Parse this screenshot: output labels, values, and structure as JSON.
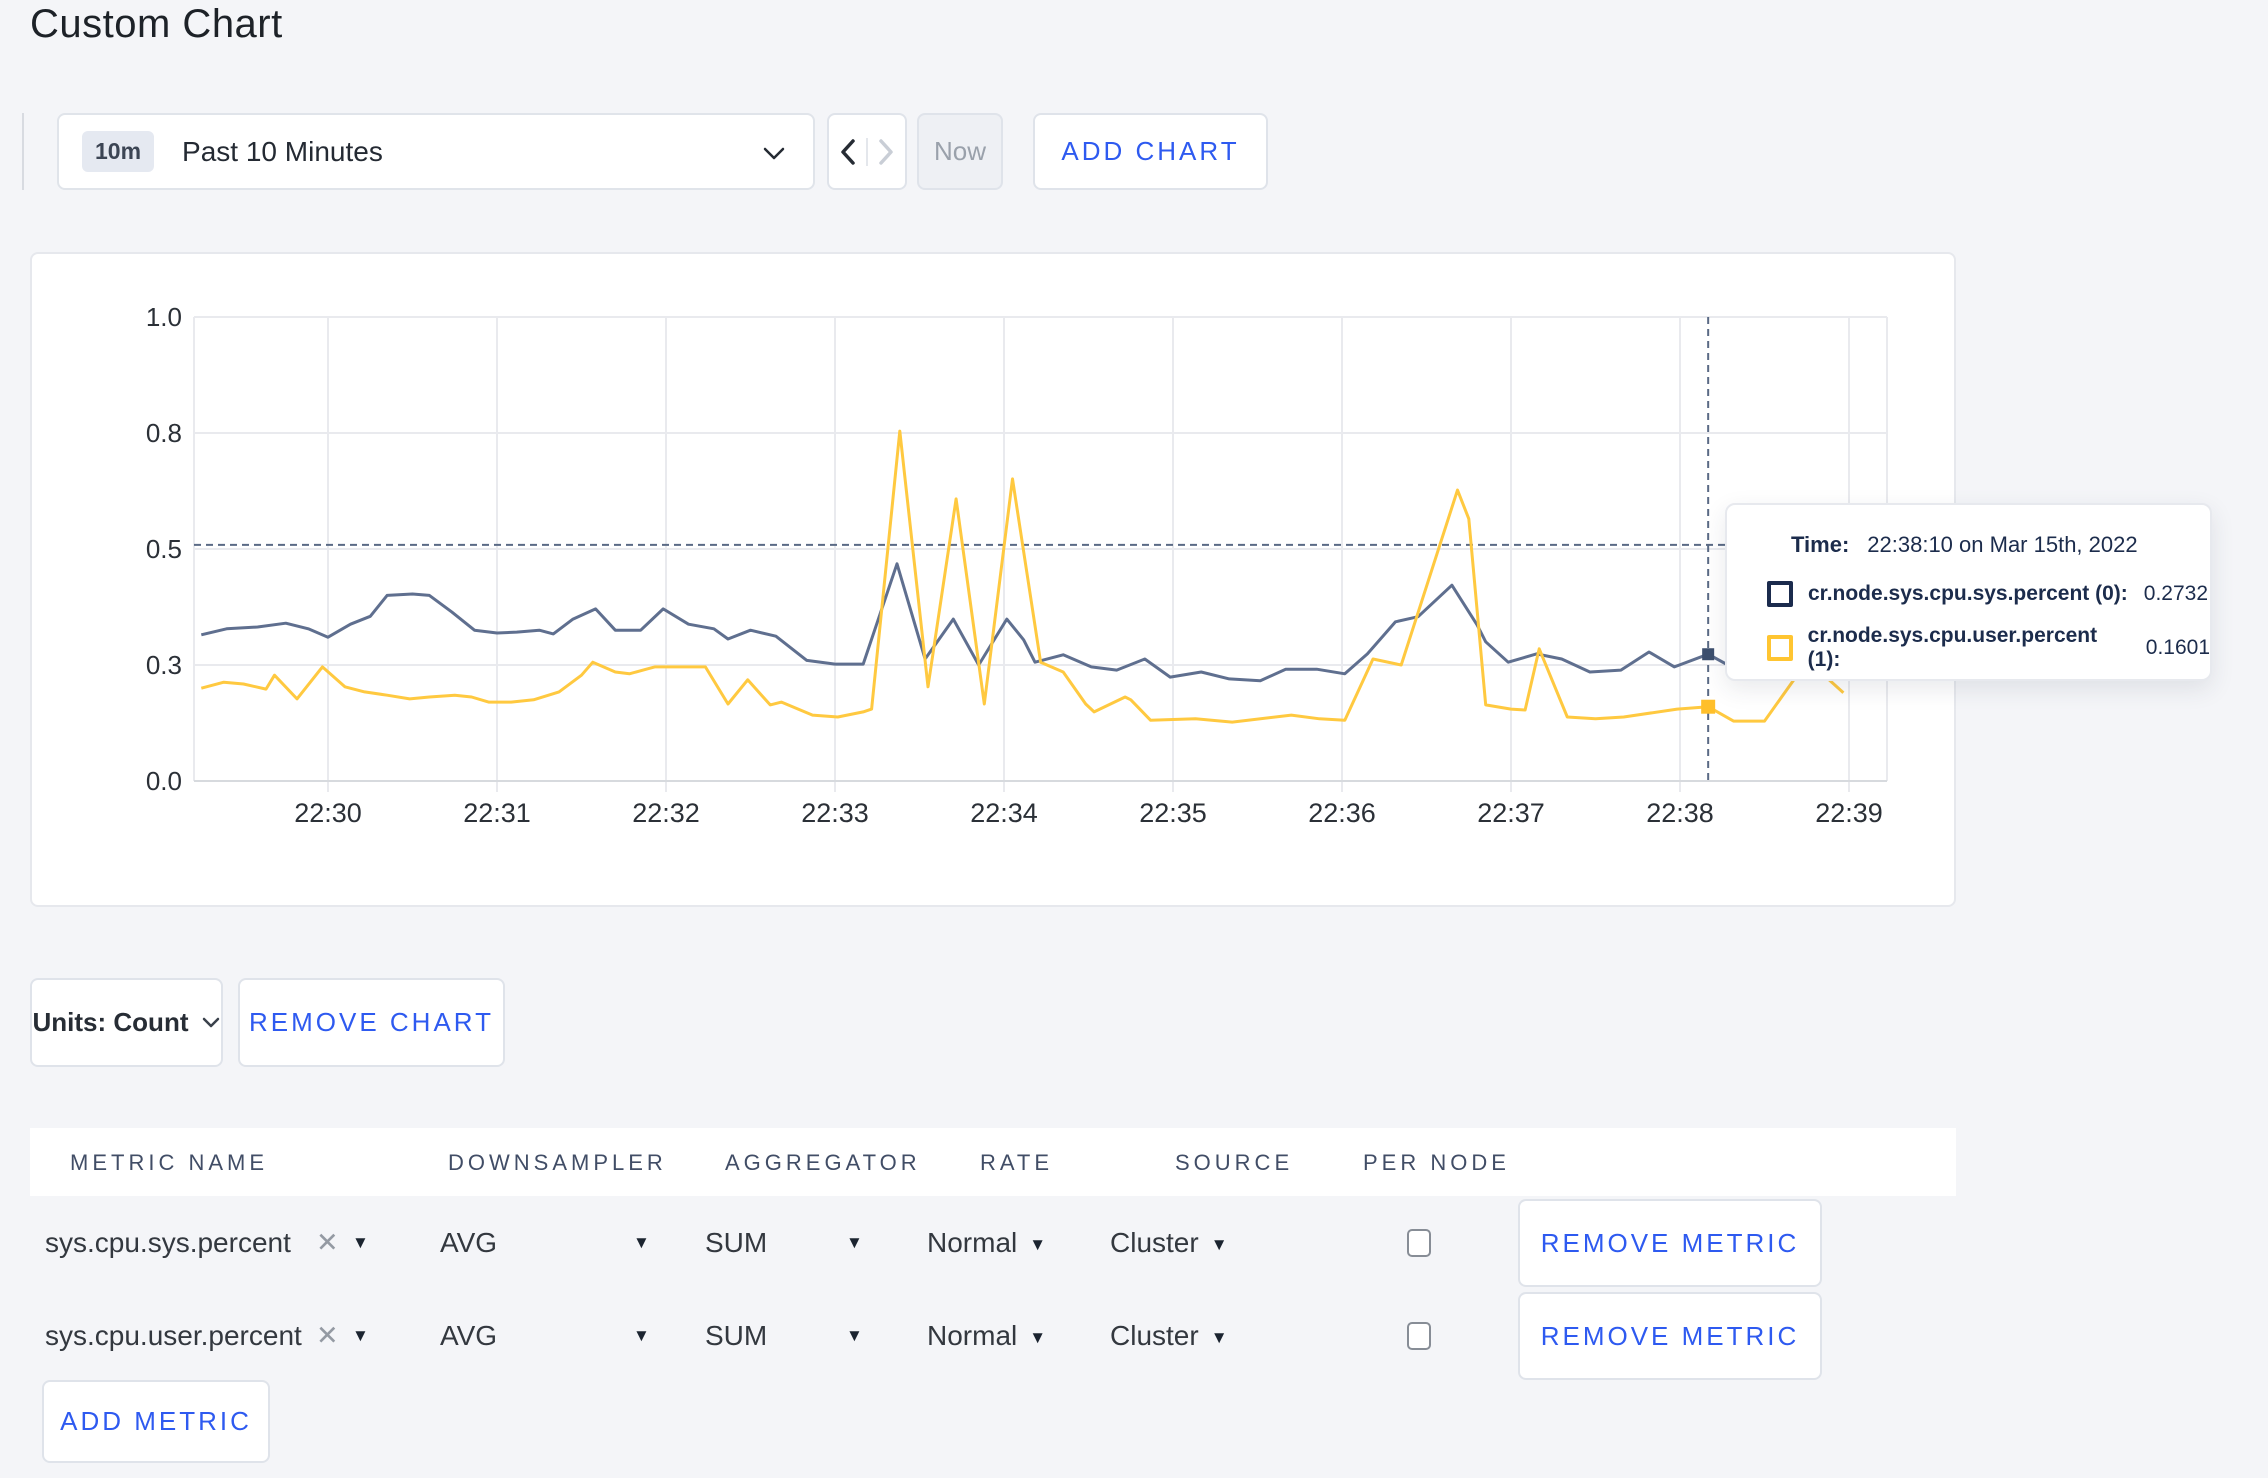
{
  "page": {
    "title": "Custom Chart"
  },
  "toolbar": {
    "range_badge": "10m",
    "range_label": "Past 10 Minutes",
    "now_label": "Now",
    "add_chart_label": "ADD CHART"
  },
  "tooltip": {
    "time_label": "Time:",
    "time_value": "22:38:10 on Mar 15th, 2022",
    "rows": [
      {
        "name": "cr.node.sys.cpu.sys.percent (0):",
        "value": "0.2732",
        "color": "#1b2b4d"
      },
      {
        "name": "cr.node.sys.cpu.user.percent (1):",
        "value": "0.1601",
        "color": "#ffc531"
      }
    ]
  },
  "units_bar": {
    "units_label": "Units: Count",
    "remove_chart_label": "REMOVE CHART"
  },
  "table": {
    "headers": [
      "METRIC NAME",
      "DOWNSAMPLER",
      "AGGREGATOR",
      "RATE",
      "SOURCE",
      "PER NODE"
    ],
    "rows": [
      {
        "metric": "sys.cpu.sys.percent",
        "downsampler": "AVG",
        "aggregator": "SUM",
        "rate": "Normal",
        "source": "Cluster",
        "per_node": false,
        "remove_label": "REMOVE METRIC"
      },
      {
        "metric": "sys.cpu.user.percent",
        "downsampler": "AVG",
        "aggregator": "SUM",
        "rate": "Normal",
        "source": "Cluster",
        "per_node": false,
        "remove_label": "REMOVE METRIC"
      }
    ],
    "add_metric_label": "ADD METRIC"
  },
  "icons": {
    "caret_down": "▼",
    "remove_x": "✕"
  },
  "colors": {
    "accent_blue": "#2e5af0",
    "series_sys": "#5f6f8f",
    "series_user": "#ffc940",
    "grid": "#e9eaee",
    "axis_line": "#d7dade",
    "crosshair": "#5a6a85",
    "page_bg": "#f4f5f8"
  },
  "chart_data": {
    "type": "line",
    "title": "",
    "xlabel": "",
    "ylabel": "",
    "ylim": [
      0,
      1
    ],
    "grid": true,
    "legend_position": "none",
    "x_axis_ticks": [
      {
        "t": 0,
        "label": "22:30"
      },
      {
        "t": 60,
        "label": "22:31"
      },
      {
        "t": 120,
        "label": "22:32"
      },
      {
        "t": 180,
        "label": "22:33"
      },
      {
        "t": 240,
        "label": "22:34"
      },
      {
        "t": 300,
        "label": "22:35"
      },
      {
        "t": 360,
        "label": "22:36"
      },
      {
        "t": 420,
        "label": "22:37"
      },
      {
        "t": 480,
        "label": "22:38"
      },
      {
        "t": 540,
        "label": "22:39"
      }
    ],
    "y_axis_ticks": [
      {
        "v": 0.0,
        "label": "0.0"
      },
      {
        "v": 0.25,
        "label": "0.3"
      },
      {
        "v": 0.5,
        "label": "0.5"
      },
      {
        "v": 0.75,
        "label": "0.8"
      },
      {
        "v": 1.0,
        "label": "1.0"
      }
    ],
    "crosshair": {
      "t": 490,
      "time_label": "22:38:10",
      "hline_value": 0.509,
      "values": [
        0.2732,
        0.1601
      ]
    },
    "series": [
      {
        "name": "cr.node.sys.cpu.sys.percent",
        "color": "#5f6f8f",
        "dot_color": "#3c4f6e",
        "dot_size": 12,
        "points": [
          [
            -45,
            0.315
          ],
          [
            -36,
            0.328
          ],
          [
            -25,
            0.332
          ],
          [
            -15,
            0.34
          ],
          [
            -7,
            0.328
          ],
          [
            0,
            0.31
          ],
          [
            8,
            0.338
          ],
          [
            15,
            0.355
          ],
          [
            21,
            0.4
          ],
          [
            30,
            0.403
          ],
          [
            36,
            0.4
          ],
          [
            44,
            0.364
          ],
          [
            52,
            0.325
          ],
          [
            60,
            0.319
          ],
          [
            67,
            0.321
          ],
          [
            75,
            0.325
          ],
          [
            80,
            0.317
          ],
          [
            87,
            0.349
          ],
          [
            95,
            0.371
          ],
          [
            102,
            0.325
          ],
          [
            111,
            0.325
          ],
          [
            119,
            0.371
          ],
          [
            128,
            0.338
          ],
          [
            137,
            0.328
          ],
          [
            142,
            0.306
          ],
          [
            150,
            0.325
          ],
          [
            159,
            0.312
          ],
          [
            170,
            0.26
          ],
          [
            180,
            0.252
          ],
          [
            190,
            0.252
          ],
          [
            202,
            0.468
          ],
          [
            212,
            0.263
          ],
          [
            222,
            0.349
          ],
          [
            231,
            0.25
          ],
          [
            241,
            0.349
          ],
          [
            247,
            0.304
          ],
          [
            251,
            0.256
          ],
          [
            261,
            0.272
          ],
          [
            271,
            0.246
          ],
          [
            280,
            0.239
          ],
          [
            290,
            0.263
          ],
          [
            299,
            0.224
          ],
          [
            310,
            0.235
          ],
          [
            320,
            0.22
          ],
          [
            331,
            0.216
          ],
          [
            340,
            0.241
          ],
          [
            351,
            0.241
          ],
          [
            361,
            0.231
          ],
          [
            369,
            0.274
          ],
          [
            379,
            0.343
          ],
          [
            387,
            0.354
          ],
          [
            399,
            0.422
          ],
          [
            408,
            0.336
          ],
          [
            411,
            0.3
          ],
          [
            419,
            0.256
          ],
          [
            429,
            0.274
          ],
          [
            438,
            0.263
          ],
          [
            448,
            0.235
          ],
          [
            459,
            0.239
          ],
          [
            469,
            0.278
          ],
          [
            478,
            0.246
          ],
          [
            490,
            0.2732
          ],
          [
            497,
            0.25
          ],
          [
            510,
            0.252
          ],
          [
            523,
            0.258
          ],
          [
            537,
            0.252
          ]
        ]
      },
      {
        "name": "cr.node.sys.cpu.user.percent",
        "color": "#ffc940",
        "dot_color": "#ffbf2a",
        "dot_size": 14,
        "points": [
          [
            -45,
            0.2
          ],
          [
            -37,
            0.213
          ],
          [
            -30,
            0.209
          ],
          [
            -22,
            0.198
          ],
          [
            -19,
            0.228
          ],
          [
            -11,
            0.177
          ],
          [
            -2,
            0.246
          ],
          [
            6,
            0.203
          ],
          [
            13,
            0.192
          ],
          [
            21,
            0.185
          ],
          [
            29,
            0.177
          ],
          [
            36,
            0.181
          ],
          [
            45,
            0.185
          ],
          [
            51,
            0.181
          ],
          [
            57,
            0.17
          ],
          [
            65,
            0.17
          ],
          [
            73,
            0.175
          ],
          [
            82,
            0.192
          ],
          [
            90,
            0.228
          ],
          [
            94,
            0.256
          ],
          [
            102,
            0.235
          ],
          [
            107,
            0.231
          ],
          [
            113,
            0.241
          ],
          [
            116,
            0.246
          ],
          [
            134,
            0.246
          ],
          [
            142,
            0.166
          ],
          [
            149,
            0.218
          ],
          [
            157,
            0.164
          ],
          [
            161,
            0.17
          ],
          [
            172,
            0.142
          ],
          [
            181,
            0.138
          ],
          [
            190,
            0.149
          ],
          [
            193,
            0.155
          ],
          [
            203,
            0.754
          ],
          [
            213,
            0.203
          ],
          [
            223,
            0.608
          ],
          [
            233,
            0.166
          ],
          [
            243,
            0.651
          ],
          [
            253,
            0.256
          ],
          [
            261,
            0.235
          ],
          [
            269,
            0.166
          ],
          [
            272,
            0.149
          ],
          [
            283,
            0.181
          ],
          [
            285,
            0.175
          ],
          [
            292,
            0.131
          ],
          [
            308,
            0.134
          ],
          [
            321,
            0.127
          ],
          [
            342,
            0.142
          ],
          [
            352,
            0.134
          ],
          [
            361,
            0.131
          ],
          [
            371,
            0.263
          ],
          [
            381,
            0.25
          ],
          [
            401,
            0.627
          ],
          [
            405,
            0.565
          ],
          [
            411,
            0.164
          ],
          [
            420,
            0.155
          ],
          [
            425,
            0.153
          ],
          [
            430,
            0.285
          ],
          [
            440,
            0.138
          ],
          [
            450,
            0.134
          ],
          [
            460,
            0.138
          ],
          [
            479,
            0.155
          ],
          [
            490,
            0.1601
          ],
          [
            499,
            0.129
          ],
          [
            510,
            0.129
          ],
          [
            523,
            0.24
          ],
          [
            528,
            0.245
          ],
          [
            538,
            0.19
          ]
        ]
      }
    ]
  }
}
